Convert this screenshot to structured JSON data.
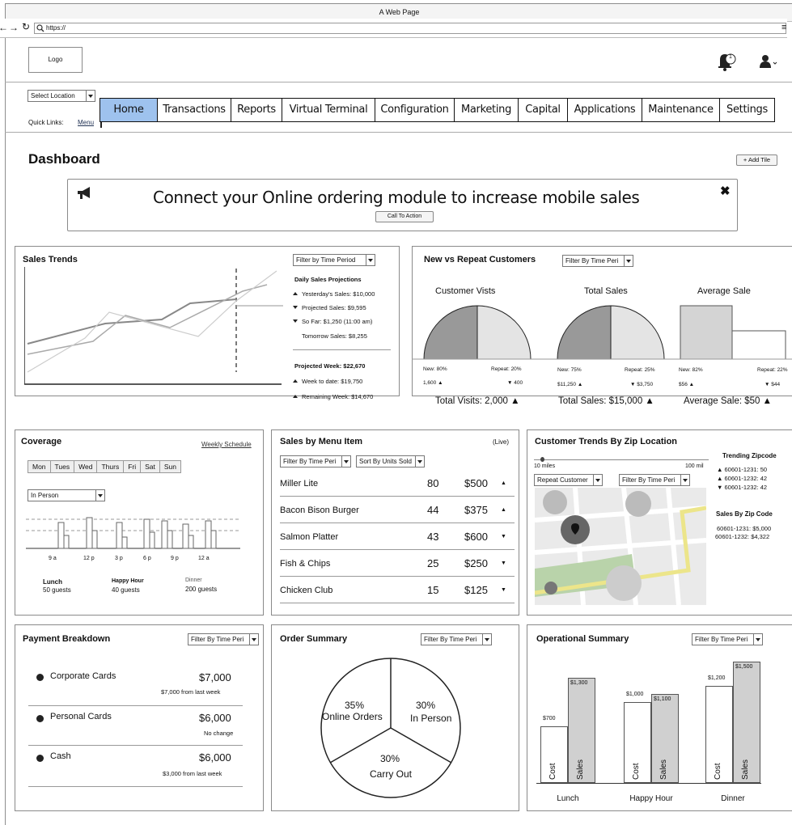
{
  "browser": {
    "title": "A Web Page",
    "url": "https://"
  },
  "header": {
    "logo": "Logo",
    "notif_count": "1"
  },
  "location": {
    "select": "Select Location",
    "quick_links": "Quick Links:",
    "menu_link": "Menu"
  },
  "nav": [
    "Home",
    "Transactions",
    "Reports",
    "Virtual Terminal",
    "Configuration",
    "Marketing",
    "Capital",
    "Applications",
    "Maintenance",
    "Settings"
  ],
  "dashboard": {
    "title": "Dashboard",
    "add_tile": "+ Add Tile"
  },
  "banner": {
    "text": "Connect your Online ordering module to increase mobile sales",
    "cta": "Call To Action"
  },
  "sales_trends": {
    "title": "Sales Trends",
    "filter": "Filter by Time Period",
    "proj_title": "Daily Sales Projections",
    "yesterday": "Yesterday's Sales: $10,000",
    "projected": "Projected Sales: $9,595",
    "sofar": "So Far: $1,250 (11:00 am)",
    "tomorrow": "Tomorrow Sales: $8,255",
    "proj_week": "Projected Week: $22,670",
    "week_to_date": "Week to date: $19,750",
    "remaining": "Remaining Week: $14,670"
  },
  "nvr": {
    "title": "New vs Repeat Customers",
    "filter": "Filter By Time Peri",
    "visits": {
      "title": "Customer Vists",
      "new": "New: 80%",
      "repeat": "Repeat: 20%",
      "new_val": "1,600",
      "repeat_val": "400",
      "total": "Total Visits: 2,000"
    },
    "sales": {
      "title": "Total Sales",
      "new": "New: 75%",
      "repeat": "Repeat: 25%",
      "new_val": "$11,250",
      "repeat_val": "$3,750",
      "total": "Total Sales: $15,000"
    },
    "avg": {
      "title": "Average Sale",
      "new": "New: 82%",
      "repeat": "Repeat: 22%",
      "new_val": "$56",
      "repeat_val": "$44",
      "total": "Average Sale: $50"
    }
  },
  "coverage": {
    "title": "Coverage",
    "link": "Weekly Schedule",
    "days": [
      "Mon",
      "Tues",
      "Wed",
      "Thurs",
      "Fri",
      "Sat",
      "Sun"
    ],
    "select": "In Person",
    "times": [
      "9 a",
      "12 p",
      "3 p",
      "6 p",
      "9 p",
      "12 a"
    ],
    "lunch": "Lunch",
    "lunch_g": "50 guests",
    "happy": "Happy Hour",
    "happy_g": "40 guests",
    "dinner": "Dinner",
    "dinner_g": "200 guests"
  },
  "menu_sales": {
    "title": "Sales by Menu Item",
    "live": "(Live)",
    "filter": "Filter By Time Peri",
    "sort": "Sort By Units Sold",
    "items": [
      {
        "name": "Miller Lite",
        "units": "80",
        "sales": "$500",
        "dir": "up"
      },
      {
        "name": "Bacon Bison Burger",
        "units": "44",
        "sales": "$375",
        "dir": "up"
      },
      {
        "name": "Salmon Platter",
        "units": "43",
        "sales": "$600",
        "dir": "down"
      },
      {
        "name": "Fish & Chips",
        "units": "25",
        "sales": "$250",
        "dir": "down"
      },
      {
        "name": "Chicken Club",
        "units": "15",
        "sales": "$125",
        "dir": "down"
      }
    ]
  },
  "zip": {
    "title": "Customer Trends By Zip Location",
    "slider_min": "10 miles",
    "slider_max": "100 mil",
    "select1": "Repeat Customer",
    "select2": "Filter By Time Peri",
    "trending_title": "Trending Zipcode",
    "trending": [
      "60601-1231: 50",
      "60601-1232: 42",
      "60601-1232: 42"
    ],
    "sales_title": "Sales By Zip Code",
    "sales": [
      "60601-1231: $5,000",
      "60601-1232: $4,322"
    ]
  },
  "payment": {
    "title": "Payment Breakdown",
    "filter": "Filter By Time Peri",
    "items": [
      {
        "label": "Corporate Cards",
        "value": "$7,000",
        "note": "$7,000 from last week"
      },
      {
        "label": "Personal Cards",
        "value": "$6,000",
        "note": "No change"
      },
      {
        "label": "Cash",
        "value": "$6,000",
        "note": "$3,000 from last week"
      }
    ]
  },
  "order": {
    "title": "Order Summary",
    "filter": "Filter By Time Peri",
    "s1_pct": "35%",
    "s1": "Online Orders",
    "s2_pct": "30%",
    "s2": "In Person",
    "s3_pct": "30%",
    "s3": "Carry Out"
  },
  "ops": {
    "title": "Operational Summary",
    "filter": "Filter By Time Peri",
    "cost": "Cost",
    "sales": "Sales",
    "groups": [
      {
        "label": "Lunch",
        "cost": "$700",
        "sales": "$1,300"
      },
      {
        "label": "Happy Hour",
        "cost": "$1,000",
        "sales": "$1,100"
      },
      {
        "label": "Dinner",
        "cost": "$1,200",
        "sales": "$1,500"
      }
    ]
  }
}
